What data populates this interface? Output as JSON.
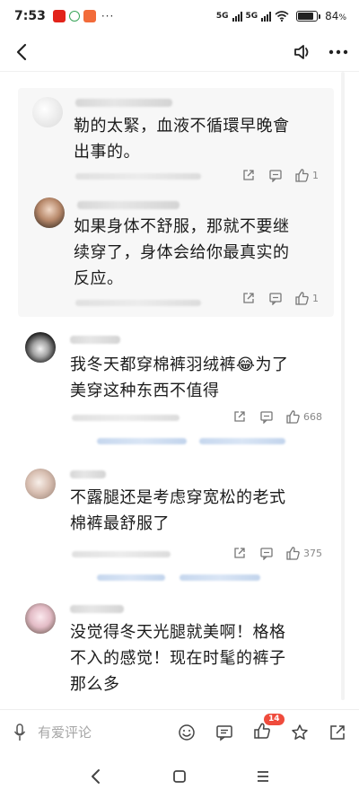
{
  "status_bar": {
    "time": "7:53",
    "network_1": "5G",
    "network_2": "5G",
    "battery_level": "84",
    "battery_unit": "%",
    "app_icons": [
      "news-app-icon",
      "circle-app-icon",
      "shopping-app-icon"
    ],
    "more": "···"
  },
  "nav": {
    "back_icon": "chevron-left-icon",
    "speaker_icon": "speaker-icon",
    "more_icon": "more-icon"
  },
  "replies": [
    {
      "text_line1": "勒的太緊，血液不循環早晚會",
      "text_line2": "出事的。",
      "likes": "1"
    },
    {
      "text_line1": "如果身体不舒服，那就不要继",
      "text_line2": "续穿了，身体会给你最真实的",
      "text_line3": "反应。",
      "likes": "1"
    }
  ],
  "comments": [
    {
      "text_line1": "我冬天都穿棉裤羽绒裤😂为了",
      "text_line2": "美穿这种东西不值得",
      "likes": "668"
    },
    {
      "text_line1": "不露腿还是考虑穿宽松的老式",
      "text_line2": "棉裤最舒服了",
      "likes": "375"
    },
    {
      "text_line1": "没觉得冬天光腿就美啊！格格",
      "text_line2": "不入的感觉！现在时髦的裤子",
      "text_line3": "那么多"
    }
  ],
  "comment_bar": {
    "placeholder": "有爱评论",
    "like_badge": "14"
  },
  "colors": {
    "badge": "#ef4b3c",
    "text": "#1b1b1b",
    "muted": "#888888",
    "reply_bg": "#f7f7f7"
  }
}
